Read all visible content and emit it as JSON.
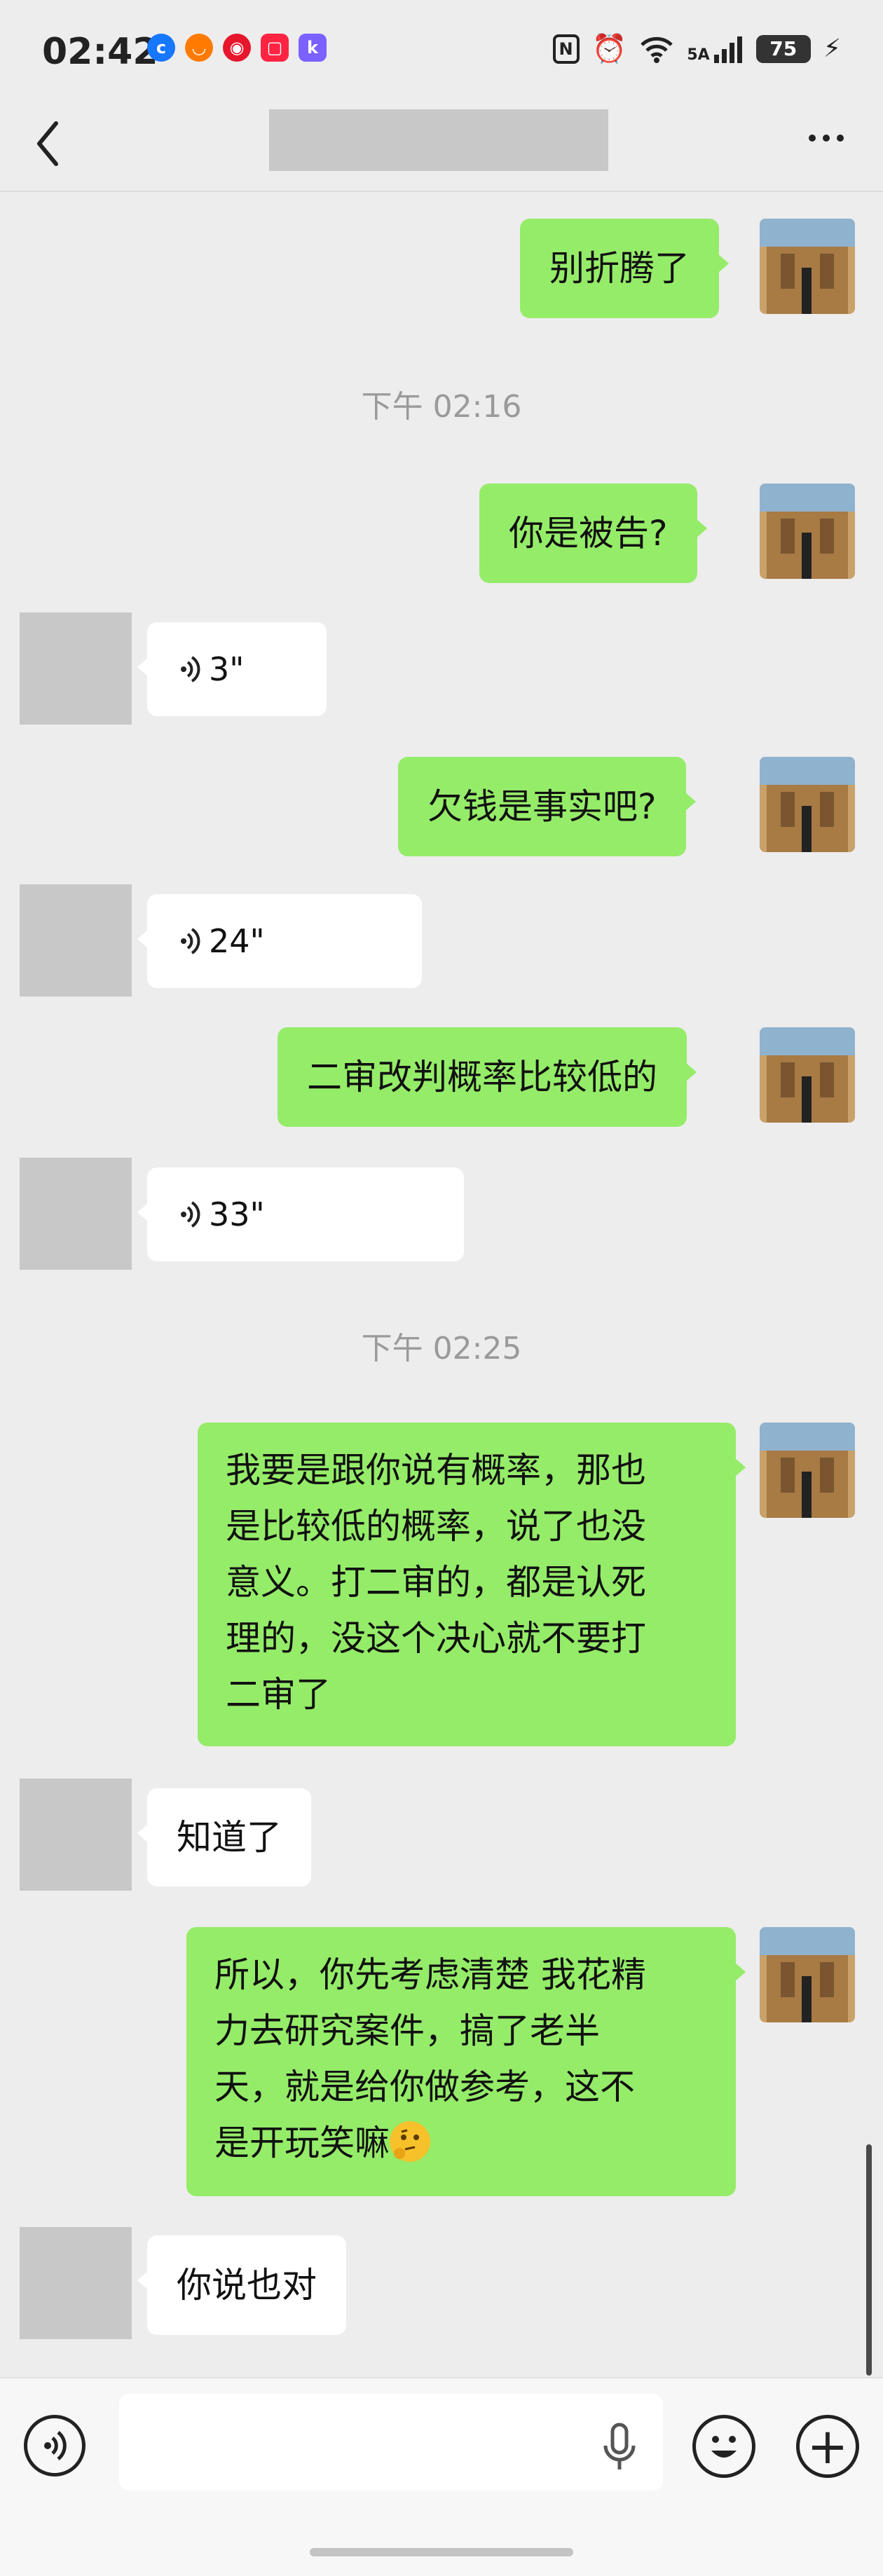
{
  "status_bar": {
    "time": "02:42",
    "network": "5A",
    "battery": "75"
  },
  "nav": {
    "title": ""
  },
  "messages": [
    {
      "side": "me",
      "text": "别折腾了"
    },
    {
      "type": "timestamp",
      "text": "下午 02:16"
    },
    {
      "side": "me",
      "text": "你是被告?"
    },
    {
      "side": "other",
      "type": "voice",
      "duration": "3\""
    },
    {
      "side": "me",
      "text": "欠钱是事实吧?"
    },
    {
      "side": "other",
      "type": "voice",
      "duration": "24\""
    },
    {
      "side": "me",
      "text": "二审改判概率比较低的"
    },
    {
      "side": "other",
      "type": "voice",
      "duration": "33\""
    },
    {
      "type": "timestamp",
      "text": "下午 02:25"
    },
    {
      "side": "me",
      "lines": [
        "我要是跟你说有概率，那也",
        "是比较低的概率，说了也没",
        "意义。打二审的，都是认死",
        "理的，没这个决心就不要打",
        "二审了"
      ]
    },
    {
      "side": "other",
      "text": "知道了"
    },
    {
      "side": "me",
      "lines": [
        "所以，你先考虑清楚 我花精",
        "力去研究案件，搞了老半",
        "天，就是给你做参考，这不",
        "是开玩笑嘛"
      ],
      "emoji": "thinking-face"
    },
    {
      "side": "other",
      "text": "你说也对"
    }
  ],
  "input": {
    "value": "",
    "placeholder": ""
  },
  "colors": {
    "background": "#ededed",
    "my_bubble": "#95ec69",
    "other_bubble": "#ffffff",
    "avatar_placeholder": "#c8c8c8"
  },
  "icons": [
    "back-icon",
    "more-icon",
    "voice-icon",
    "mic-icon",
    "emoji-icon",
    "plus-icon",
    "thinking-face-emoji"
  ]
}
